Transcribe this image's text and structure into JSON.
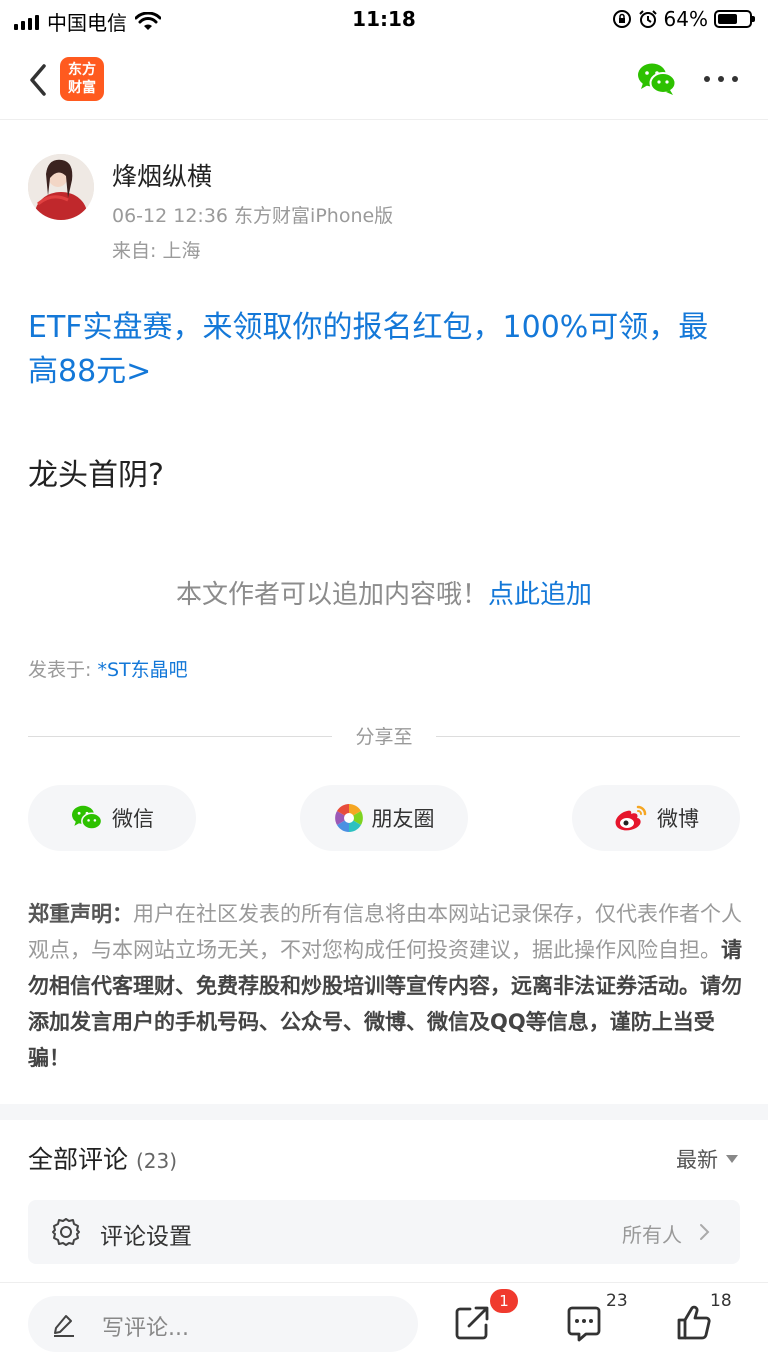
{
  "status_bar": {
    "carrier": "中国电信",
    "time": "11:18",
    "battery": "64%",
    "battery_level": 0.64
  },
  "nav": {
    "logo_line1": "东方",
    "logo_line2": "财富",
    "icons": [
      "back-icon",
      "wechat-icon",
      "more-icon"
    ]
  },
  "post": {
    "author": "烽烟纵横",
    "meta": "06-12 12:36 东方财富iPhone版",
    "location": "来自: 上海",
    "promo": "ETF实盘赛，来领取你的报名红包，100%可领，最高88元>",
    "body": "龙头首阴?",
    "append_text": "本文作者可以追加内容哦！",
    "append_link": "点此追加",
    "posted_in_label": "发表于: ",
    "forum": "*ST东晶吧"
  },
  "share": {
    "title": "分享至",
    "buttons": [
      {
        "label": "微信",
        "icon": "wechat-icon"
      },
      {
        "label": "朋友圈",
        "icon": "moments-icon"
      },
      {
        "label": "微博",
        "icon": "weibo-icon"
      }
    ]
  },
  "disclaimer": {
    "title": "郑重声明：",
    "text": "用户在社区发表的所有信息将由本网站记录保存，仅代表作者个人观点，与本网站立场无关，不对您构成任何投资建议，据此操作风险自担。",
    "warning": "请勿相信代客理财、免费荐股和炒股培训等宣传内容，远离非法证券活动。请勿添加发言用户的手机号码、公众号、微博、微信及QQ等信息，谨防上当受骗！"
  },
  "comments": {
    "title": "全部评论",
    "count": "(23)",
    "sort": "最新",
    "settings_label": "评论设置",
    "settings_value": "所有人"
  },
  "bottom_bar": {
    "placeholder": "写评论...",
    "share_badge": "1",
    "comment_count": "23",
    "like_count": "18"
  },
  "colors": {
    "link_blue": "#1478d8",
    "brand_orange": "#ff5a1f",
    "badge_red": "#f03a2e",
    "wechat_green": "#2dc100"
  }
}
